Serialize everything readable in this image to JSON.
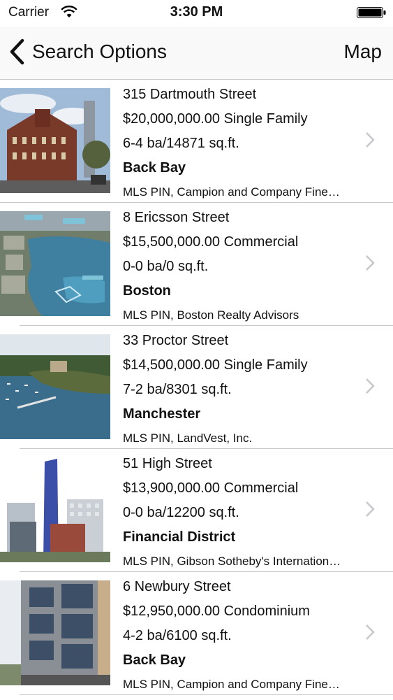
{
  "status": {
    "carrier": "Carrier",
    "time": "3:30 PM"
  },
  "nav": {
    "back_label": "Search Options",
    "right_label": "Map"
  },
  "listings": [
    {
      "address": "315 Dartmouth Street",
      "price_type": "$20,000,000.00 Single Family",
      "details": "6-4 ba/14871 sq.ft.",
      "neighborhood": "Back Bay",
      "broker": "MLS PIN, Campion and Company Fine…"
    },
    {
      "address": "8 Ericsson Street",
      "price_type": "$15,500,000.00 Commercial",
      "details": "0-0 ba/0 sq.ft.",
      "neighborhood": "Boston",
      "broker": "MLS PIN, Boston Realty Advisors"
    },
    {
      "address": "33 Proctor Street",
      "price_type": "$14,500,000.00 Single Family",
      "details": "7-2 ba/8301 sq.ft.",
      "neighborhood": "Manchester",
      "broker": "MLS PIN, LandVest, Inc."
    },
    {
      "address": "51 High Street",
      "price_type": "$13,900,000.00 Commercial",
      "details": "0-0 ba/12200 sq.ft.",
      "neighborhood": "Financial District",
      "broker": "MLS PIN, Gibson Sotheby's Internation…"
    },
    {
      "address": "6 Newbury Street",
      "price_type": "$12,950,000.00 Condominium",
      "details": "4-2 ba/6100 sq.ft.",
      "neighborhood": "Back Bay",
      "broker": "MLS PIN, Campion and Company Fine…"
    }
  ],
  "icons": {
    "back": "chevron-left-icon",
    "disclosure": "chevron-right-icon",
    "wifi": "wifi-icon",
    "battery": "battery-icon"
  },
  "colors": {
    "separator": "#c8c7cc",
    "chevron": "#c7c7cc"
  }
}
